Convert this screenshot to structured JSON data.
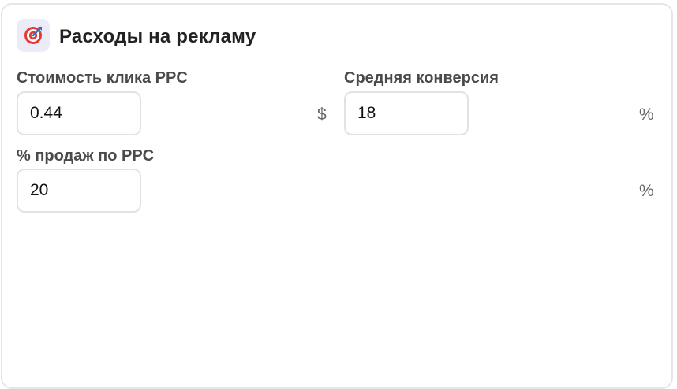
{
  "panel": {
    "title": "Расходы на рекламу",
    "icon": "target-icon"
  },
  "fields": {
    "cpc": {
      "label": "Стоимость клика PPC",
      "value": "0.44",
      "unit": "$"
    },
    "conversion": {
      "label": "Средняя конверсия",
      "value": "18",
      "unit": "%"
    },
    "ppc_sales": {
      "label": "% продаж по PPC",
      "value": "20",
      "unit": "%"
    }
  }
}
